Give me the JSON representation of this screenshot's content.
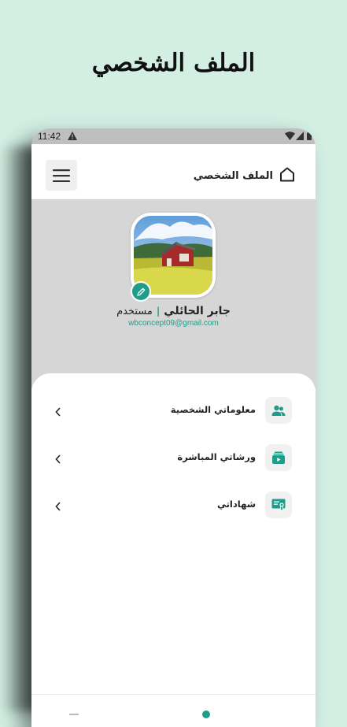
{
  "promo": {
    "title": "الملف الشخصي"
  },
  "status_bar": {
    "time": "11:42"
  },
  "header": {
    "title": "الملف الشخصي"
  },
  "profile": {
    "name": "جابر الحائلي",
    "separator": "|",
    "role": "مستخدم",
    "email": "wbconcept09@gmail.com"
  },
  "menu": {
    "items": [
      {
        "label": "معلوماتي الشخصية",
        "icon": "users-icon"
      },
      {
        "label": "ورشاتي المباشرة",
        "icon": "live-workshop-icon"
      },
      {
        "label": "شهاداتي",
        "icon": "certificate-icon"
      }
    ]
  },
  "colors": {
    "accent": "#1f9d8b",
    "background": "#d3efe4",
    "profile_bg": "#d6d6d6"
  }
}
